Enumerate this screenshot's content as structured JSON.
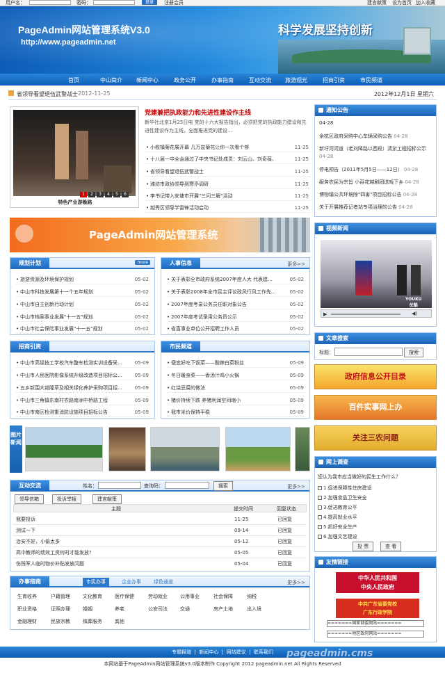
{
  "topbar": {
    "user_label": "用户名：",
    "pass_label": "密码：",
    "login_btn": "登录",
    "register": "注册会员",
    "suggest": "建言献策",
    "home": "设为首页",
    "fav": "加入收藏"
  },
  "banner": {
    "title": "PageAdmin网站管理系统V3.0",
    "url": "http://www.pageadmin.net",
    "slogan": "科学发展坚持创新"
  },
  "nav": [
    "首页",
    "中山简介",
    "新闻中心",
    "政务公开",
    "办事指南",
    "互动交流",
    "旅游观光",
    "招商引资",
    "市民频道"
  ],
  "notice": {
    "text": "省领导看望退伍武警战士",
    "date": "2012-11-25",
    "today": "2012年12月1日 星期六"
  },
  "feature": {
    "caption": "特色产业游晚路",
    "pages": [
      "1",
      "2",
      "3",
      "4",
      "5",
      "6"
    ],
    "headline": "党建兼把执政能力和先进性建设作主线",
    "summary": "新华社北京1月25日电 党的十六大报告指出，必须把党的执政能力建设和先进性建设作为主线，全面推进党的建设...",
    "items": [
      {
        "t": "小榄镇菊花展开幕 几万盆菊花让你一次看个够",
        "d": "11-25"
      },
      {
        "t": "十八届一中全会通过了中央书记处成员：刘云山、刘奇葆、",
        "d": "11-25"
      },
      {
        "t": "省领导看望退伍武警战士",
        "d": "11-25"
      },
      {
        "t": "潍坊市政协领导到寒亭调研",
        "d": "11-25"
      },
      {
        "t": "李书记带入安塘市开展\"三问三解\"活动",
        "d": "11-25"
      },
      {
        "t": "越秀区领导学雷锋活动启动",
        "d": "11-25"
      }
    ]
  },
  "adbanner": "PageAdmin网站管理系统",
  "plan": {
    "title": "规划计划",
    "badge": "more",
    "items": [
      {
        "t": "旅游资源及环境保护规划",
        "d": "05-02"
      },
      {
        "t": "中山市科技发展第十一个五年规划",
        "d": "05-02"
      },
      {
        "t": "中山市自主创新行动计划",
        "d": "05-02"
      },
      {
        "t": "中山市档案事业发展\"十一五\"规划",
        "d": "05-02"
      },
      {
        "t": "中山市社会保险事业发展\"十一五\"规划",
        "d": "05-02"
      }
    ]
  },
  "hr": {
    "title": "人事信息",
    "more": "更多>>",
    "items": [
      {
        "t": "关于表彰全市政府系统2007年度人大 代表建...",
        "d": "05-02"
      },
      {
        "t": "关于表彰2008年全市民主评议政风行风工作先...",
        "d": "05-02"
      },
      {
        "t": "2007年度考录公务员任职对象公告",
        "d": "05-02"
      },
      {
        "t": "2007年度考试录用公务员公示",
        "d": "05-02"
      },
      {
        "t": "省直事业单位公开招聘工作人员",
        "d": "05-02"
      }
    ]
  },
  "invest": {
    "title": "招商引资",
    "items": [
      {
        "t": "中山市高级技工学校汽车整车检测实训设备采...",
        "d": "05-09"
      },
      {
        "t": "中山市人民医院影像系统升级改造项目招标公...",
        "d": "05-09"
      },
      {
        "t": "五乡新围大锡隆草及相关绿化养护采购项目招...",
        "d": "05-09"
      },
      {
        "t": "中山市三角镇东南村农路南洲中桥路工程",
        "d": "05-09"
      },
      {
        "t": "中山市南区检测重消防设施项目招标公告",
        "d": "05-09"
      }
    ]
  },
  "citizen": {
    "title": "市民频道",
    "items": [
      {
        "t": "便宜好吃下饭菜——酸辣白菜粉丝",
        "d": "05-09"
      },
      {
        "t": "冬日暖身菜——香汤汁鸡小火锅",
        "d": "05-09"
      },
      {
        "t": "红烧豆腐的做法",
        "d": "05-09"
      },
      {
        "t": "猪价持续下跌 养猪利润空间缩小",
        "d": "05-09"
      },
      {
        "t": "我市米价保持平稳",
        "d": "05-09"
      }
    ]
  },
  "photos": {
    "label": "图片新闻"
  },
  "interact": {
    "title": "互动交流",
    "name_label": "姓名：",
    "code_label": "查询码：",
    "search": "搜索",
    "more": "更多>>",
    "tabs": [
      "领导信箱",
      "投诉举报",
      "建言献策"
    ],
    "cols": [
      "主题",
      "提交时间",
      "回复状态"
    ],
    "rows": [
      {
        "t": "我要投诉",
        "d": "11-25",
        "s": "已回复"
      },
      {
        "t": "测试一下",
        "d": "09-14",
        "s": "已回复"
      },
      {
        "t": "治安不好，小偷太多",
        "d": "05-12",
        "s": "已回复"
      },
      {
        "t": "高中教师的绩效工资何时才能发放?",
        "d": "05-05",
        "s": "已回复"
      },
      {
        "t": "伤残军人临时物价补贴发放问题",
        "d": "05-04",
        "s": "已回复"
      }
    ]
  },
  "guide": {
    "title": "办事指南",
    "tabs": [
      "市民办事",
      "企业办事",
      "绿色通道"
    ],
    "more": "更多>>",
    "items": [
      "生育收养",
      "户籍管理",
      "文化教育",
      "医疗保健",
      "劳动就业",
      "公用事业",
      "社会保障",
      "纳税",
      "职业资格",
      "证照办理",
      "婚姻",
      "养老",
      "公安司法",
      "交通",
      "房产土地",
      "出入境",
      "金融理财",
      "民族宗教",
      "殡葬服务",
      "其他"
    ]
  },
  "notices": {
    "title": "通知公告",
    "first_date": "04-28",
    "items": [
      {
        "t": "余杭区政府采购中心车辆采购公告",
        "d": "04-28"
      },
      {
        "t": "新圩河河道（老刘降路以西段）清淤工程招标公示",
        "d": "04-28"
      },
      {
        "t": "停电预告（2011年5月5日——12日）",
        "d": "04-28"
      },
      {
        "t": "服务农民为宗旨 小百花越剧团送戏下乡",
        "d": "04-28"
      },
      {
        "t": "博物镇公共环境除\"四害\"项目招标公告",
        "d": "04-28"
      },
      {
        "t": "关于开展推荐记者站专项治理的公告",
        "d": "04-28"
      }
    ]
  },
  "video": {
    "title": "视频新闻",
    "brand": "YOUKU",
    "brand_sub": "优酷"
  },
  "search": {
    "title": "文章搜索",
    "label": "标题：",
    "btn": "搜索"
  },
  "promos": [
    "政府信息公开目录",
    "百件实事网上办",
    "关注三农问题"
  ],
  "survey": {
    "title": "网上调查",
    "question": "您认为我市应当做好的民生工作什么？",
    "options": [
      "1.促进保障性住房建设",
      "2.加强食品卫生安全",
      "3.促进教育公平",
      "4.提高就业水平",
      "5.抓好安全生产",
      "6.加强文艺建设"
    ],
    "vote": "投 票",
    "view": "查 看"
  },
  "links": {
    "title": "友情链接",
    "gov1": "中华人民共和国",
    "gov1b": "中央人民政府",
    "gov2": "中共广东省委党校",
    "gov2b": "广东行政学院",
    "sel1": "=======国家部委网站=======",
    "sel2": "=======地区政府网站======="
  },
  "footer": {
    "links": [
      "专题报道",
      "新闻中心",
      "网站建议",
      "联系我们"
    ],
    "copyright": "本网站基于PageAdmin网站管理系统v3.0版本制作 Copyright 2012 pageadmin.net All Rights Reserved",
    "watermark": "pageadmin.cms"
  }
}
